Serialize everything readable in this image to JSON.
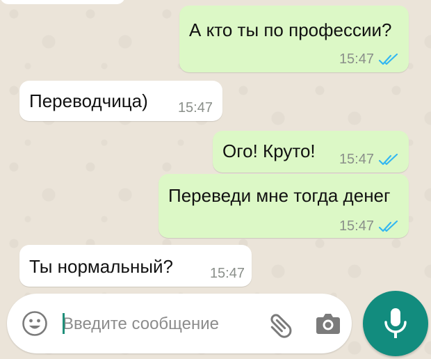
{
  "messages": [
    {
      "direction": "outgoing",
      "text": "А кто ты по профессии?",
      "time": "15:47",
      "status": "read"
    },
    {
      "direction": "incoming",
      "text": "Переводчица)",
      "time": "15:47"
    },
    {
      "direction": "outgoing",
      "text": "Ого! Круто!",
      "time": "15:47",
      "status": "read"
    },
    {
      "direction": "outgoing",
      "text": "Переведи мне тогда денег",
      "time": "15:47",
      "status": "read"
    },
    {
      "direction": "incoming",
      "text": "Ты нормальный?",
      "time": "15:47"
    }
  ],
  "composer": {
    "placeholder": "Введите сообщение",
    "emoji_icon": "smiley-icon",
    "attach_icon": "paperclip-icon",
    "camera_icon": "camera-icon",
    "send_icon": "microphone-icon"
  },
  "colors": {
    "outgoing_bubble": "#dcf8c6",
    "incoming_bubble": "#ffffff",
    "read_ticks": "#34b7f1",
    "accent": "#128c7e",
    "wallpaper": "#ebe4d9"
  }
}
